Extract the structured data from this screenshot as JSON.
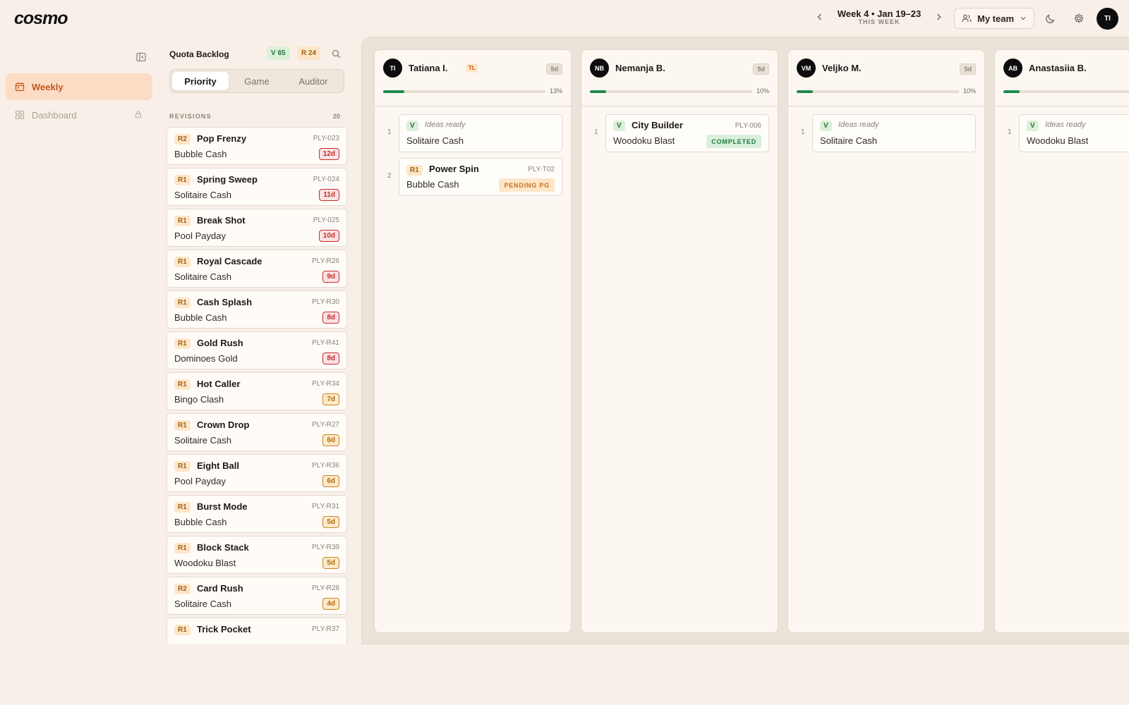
{
  "app": {
    "logo": "cosmo"
  },
  "header": {
    "week_title": "Week 4 • Jan 19–23",
    "week_sub": "THIS WEEK",
    "team_label": "My team",
    "user_initials": "TI"
  },
  "nav": {
    "items": [
      {
        "label": "Weekly",
        "icon": "calendar-icon",
        "active": true
      },
      {
        "label": "Dashboard",
        "icon": "grid-icon",
        "locked": true
      }
    ]
  },
  "backlog": {
    "title": "Quota Backlog",
    "v_count": "V 65",
    "r_count": "R 24",
    "tabs": [
      "Priority",
      "Game",
      "Auditor"
    ],
    "active_tab": "Priority",
    "section_label": "REVISIONS",
    "section_count": "20",
    "items": [
      {
        "badge": "R2",
        "name": "Pop Frenzy",
        "code": "PLY-023",
        "game": "Bubble Cash",
        "days": "12d",
        "urgency": "red"
      },
      {
        "badge": "R1",
        "name": "Spring Sweep",
        "code": "PLY-024",
        "game": "Solitaire Cash",
        "days": "11d",
        "urgency": "red"
      },
      {
        "badge": "R1",
        "name": "Break Shot",
        "code": "PLY-025",
        "game": "Pool Payday",
        "days": "10d",
        "urgency": "red"
      },
      {
        "badge": "R1",
        "name": "Royal Cascade",
        "code": "PLY-R26",
        "game": "Solitaire Cash",
        "days": "9d",
        "urgency": "red"
      },
      {
        "badge": "R1",
        "name": "Cash Splash",
        "code": "PLY-R30",
        "game": "Bubble Cash",
        "days": "8d",
        "urgency": "red"
      },
      {
        "badge": "R1",
        "name": "Gold Rush",
        "code": "PLY-R41",
        "game": "Dominoes Gold",
        "days": "8d",
        "urgency": "red"
      },
      {
        "badge": "R1",
        "name": "Hot Caller",
        "code": "PLY-R34",
        "game": "Bingo Clash",
        "days": "7d",
        "urgency": "amber"
      },
      {
        "badge": "R1",
        "name": "Crown Drop",
        "code": "PLY-R27",
        "game": "Solitaire Cash",
        "days": "6d",
        "urgency": "amber"
      },
      {
        "badge": "R1",
        "name": "Eight Ball",
        "code": "PLY-R36",
        "game": "Pool Payday",
        "days": "6d",
        "urgency": "amber"
      },
      {
        "badge": "R1",
        "name": "Burst Mode",
        "code": "PLY-R31",
        "game": "Bubble Cash",
        "days": "5d",
        "urgency": "amber"
      },
      {
        "badge": "R1",
        "name": "Block Stack",
        "code": "PLY-R39",
        "game": "Woodoku Blast",
        "days": "5d",
        "urgency": "amber"
      },
      {
        "badge": "R2",
        "name": "Card Rush",
        "code": "PLY-R28",
        "game": "Solitaire Cash",
        "days": "4d",
        "urgency": "amber"
      },
      {
        "badge": "R1",
        "name": "Trick Pocket",
        "code": "PLY-R37",
        "game": "",
        "days": "",
        "urgency": "amber"
      }
    ]
  },
  "board": {
    "columns": [
      {
        "initials": "TI",
        "name": "Tatiana I.",
        "tl": "TL",
        "days": "5d",
        "progress": 13,
        "pct": "13%",
        "items": [
          {
            "num": "1",
            "type": "V",
            "badge": "V",
            "note": "Ideas ready",
            "name": "",
            "code": "",
            "game": "Solitaire Cash",
            "status": ""
          },
          {
            "num": "2",
            "type": "R",
            "badge": "R1",
            "note": "",
            "name": "Power Spin",
            "code": "PLY-T02",
            "game": "Bubble Cash",
            "status": "PENDING PG",
            "status_kind": "pending"
          }
        ]
      },
      {
        "initials": "NB",
        "name": "Nemanja B.",
        "tl": "",
        "days": "5d",
        "progress": 10,
        "pct": "10%",
        "items": [
          {
            "num": "1",
            "type": "V-named",
            "badge": "V",
            "note": "",
            "name": "City Builder",
            "code": "PLY-006",
            "game": "Woodoku Blast",
            "status": "COMPLETED",
            "status_kind": "completed"
          }
        ]
      },
      {
        "initials": "VM",
        "name": "Veljko M.",
        "tl": "",
        "days": "5d",
        "progress": 10,
        "pct": "10%",
        "items": [
          {
            "num": "1",
            "type": "V",
            "badge": "V",
            "note": "Ideas ready",
            "name": "",
            "code": "",
            "game": "Solitaire Cash",
            "status": ""
          }
        ]
      },
      {
        "initials": "AB",
        "name": "Anastasiia B.",
        "tl": "",
        "days": "",
        "progress": 10,
        "pct": "",
        "items": [
          {
            "num": "1",
            "type": "V",
            "badge": "V",
            "note": "Ideas ready",
            "name": "",
            "code": "",
            "game": "Woodoku Blast",
            "status": ""
          }
        ]
      }
    ]
  }
}
